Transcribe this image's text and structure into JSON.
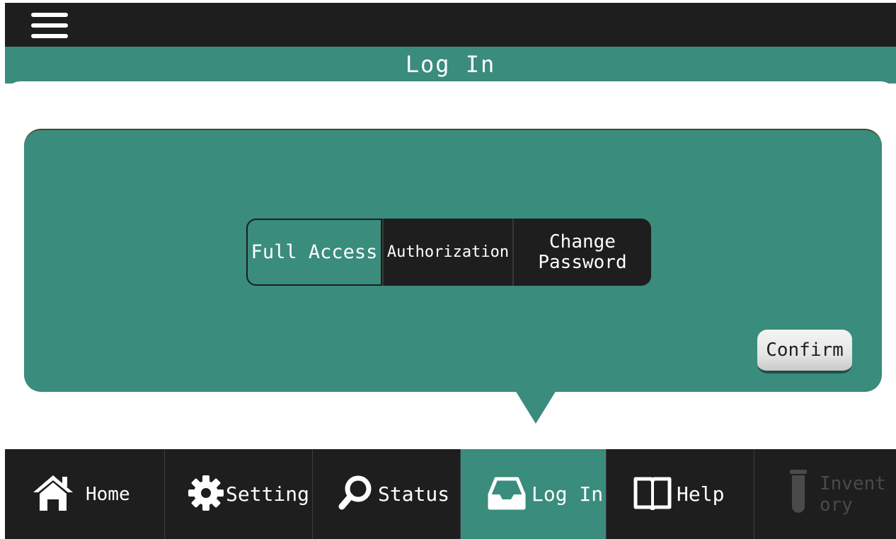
{
  "header": {
    "menu_icon": "hamburger-menu-icon",
    "title": "Log In"
  },
  "access": {
    "options": [
      "Full Access",
      "Authorization",
      "Change\nPassword"
    ],
    "selected": "Full Access",
    "confirm_label": "Confirm"
  },
  "nav": {
    "items": [
      {
        "label": "Home",
        "icon": "home-icon",
        "active": false,
        "enabled": true
      },
      {
        "label": "Setting",
        "icon": "gear-icon",
        "active": false,
        "enabled": true
      },
      {
        "label": "Status",
        "icon": "search-icon",
        "active": false,
        "enabled": true
      },
      {
        "label": "Log In",
        "icon": "inbox-tray-icon",
        "active": true,
        "enabled": true
      },
      {
        "label": "Help",
        "icon": "book-icon",
        "active": false,
        "enabled": true
      },
      {
        "label": "Invent\nory",
        "icon": "test-tube-icon",
        "active": false,
        "enabled": false
      }
    ]
  },
  "colors": {
    "teal": "#3a8c7c",
    "dark": "#1e1e1e",
    "white": "#ffffff",
    "disabled": "#4a4a4a"
  }
}
